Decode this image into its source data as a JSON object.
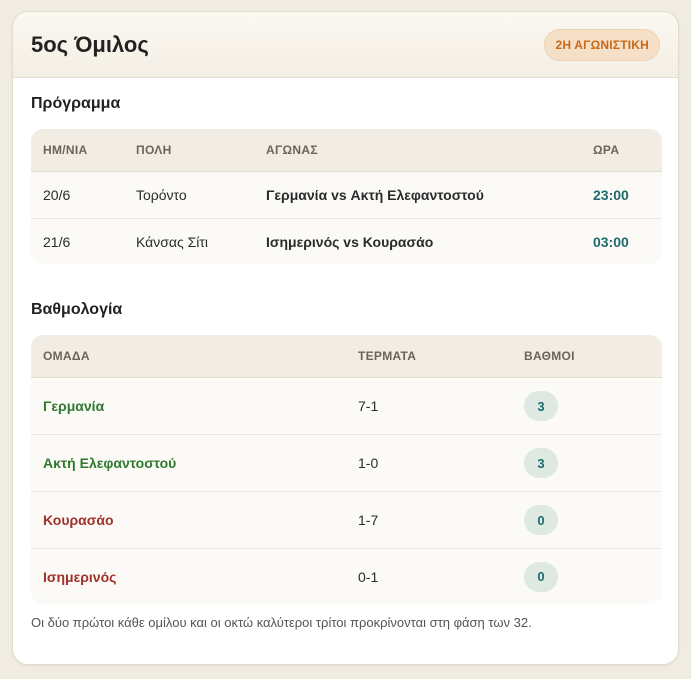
{
  "header": {
    "title": "5ος Όμιλος",
    "badge": "2Η ΑΓΩΝΙΣΤΙΚΗ"
  },
  "schedule": {
    "title": "Πρόγραμμα",
    "columns": [
      "ΗΜ/ΝΙΑ",
      "ΠΟΛΗ",
      "ΑΓΩΝΑΣ",
      "ΩΡΑ"
    ],
    "rows": [
      {
        "date": "20/6",
        "city": "Τορόντο",
        "match": "Γερμανία vs Ακτή Ελεφαντοστού",
        "time": "23:00"
      },
      {
        "date": "21/6",
        "city": "Κάνσας Σίτι",
        "match": "Ισημερινός vs Κουρασάο",
        "time": "03:00"
      }
    ]
  },
  "standings": {
    "title": "Βαθμολογία",
    "columns": [
      "ΟΜΑΔΑ",
      "ΤΕΡΜΑΤΑ",
      "ΒΑΘΜΟΙ"
    ],
    "rows": [
      {
        "team": "Γερμανία",
        "goals": "7-1",
        "points": "3",
        "status": "qualified"
      },
      {
        "team": "Ακτή Ελεφαντοστού",
        "goals": "1-0",
        "points": "3",
        "status": "qualified"
      },
      {
        "team": "Κουρασάο",
        "goals": "1-7",
        "points": "0",
        "status": "out"
      },
      {
        "team": "Ισημερινός",
        "goals": "0-1",
        "points": "0",
        "status": "out"
      }
    ]
  },
  "note": "Οι δύο πρώτοι κάθε ομίλου και οι οκτώ καλύτεροι τρίτοι προκρίνονται στη φάση των 32.",
  "colors": {
    "qualified": "#2f7a2f",
    "out": "#a0302a",
    "time": "#1f6b6b",
    "badge_text": "#c66a1a"
  }
}
